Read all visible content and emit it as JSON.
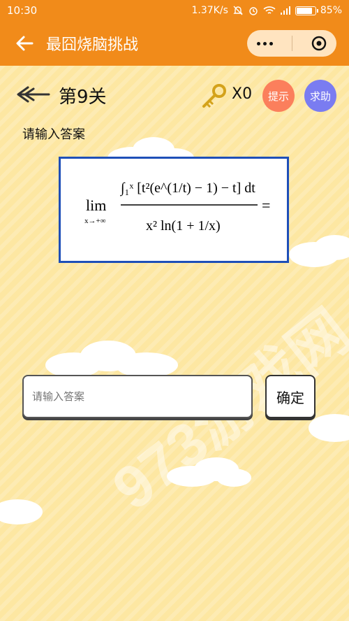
{
  "status": {
    "time": "10:30",
    "network_speed": "1.37K/s",
    "battery_percent": "85%",
    "battery_level": 0.85
  },
  "nav": {
    "title": "最囧烧脑挑战",
    "back_icon": "back-arrow-icon",
    "more_icon": "more-dots-icon",
    "target_icon": "target-icon"
  },
  "game": {
    "level_label": "第9关",
    "key_count": "X0",
    "hint_label": "提示",
    "help_label": "求助",
    "prompt_label": "请输入答案",
    "formula": {
      "lim_word": "lim",
      "lim_sub": "x→+∞",
      "numerator": "∫₁ˣ [t²(e^(1/t) − 1) − t] dt",
      "denominator": "x² ln(1 + 1/x)",
      "equals": "="
    }
  },
  "answer": {
    "placeholder": "请输入答案",
    "confirm_label": "确定"
  },
  "colors": {
    "nav_bg": "#f18b1a",
    "page_bg": "#fde7a2",
    "hint_btn": "#fb7f5c",
    "help_btn": "#7a7cf1",
    "formula_border": "#1e4fb8"
  }
}
